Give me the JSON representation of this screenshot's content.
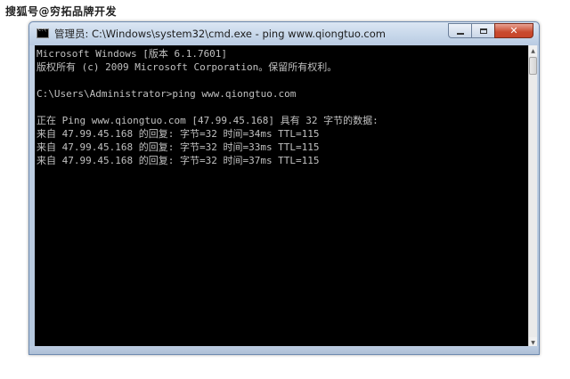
{
  "watermark": "搜狐号@穷拓品牌开发",
  "window": {
    "title": "管理员: C:\\Windows\\system32\\cmd.exe - ping  www.qiongtuo.com",
    "buttons": {
      "minimize": "minimize",
      "maximize": "maximize",
      "close": "✕"
    }
  },
  "console": {
    "lines": [
      "Microsoft Windows [版本 6.1.7601]",
      "版权所有 (c) 2009 Microsoft Corporation。保留所有权利。",
      "",
      "C:\\Users\\Administrator>ping www.qiongtuo.com",
      "",
      "正在 Ping www.qiongtuo.com [47.99.45.168] 具有 32 字节的数据:",
      "来自 47.99.45.168 的回复: 字节=32 时间=34ms TTL=115",
      "来自 47.99.45.168 的回复: 字节=32 时间=33ms TTL=115",
      "来自 47.99.45.168 的回复: 字节=32 时间=37ms TTL=115"
    ]
  },
  "colors": {
    "console_bg": "#000000",
    "console_fg": "#c0c0c0",
    "close_button": "#c94a2e"
  }
}
